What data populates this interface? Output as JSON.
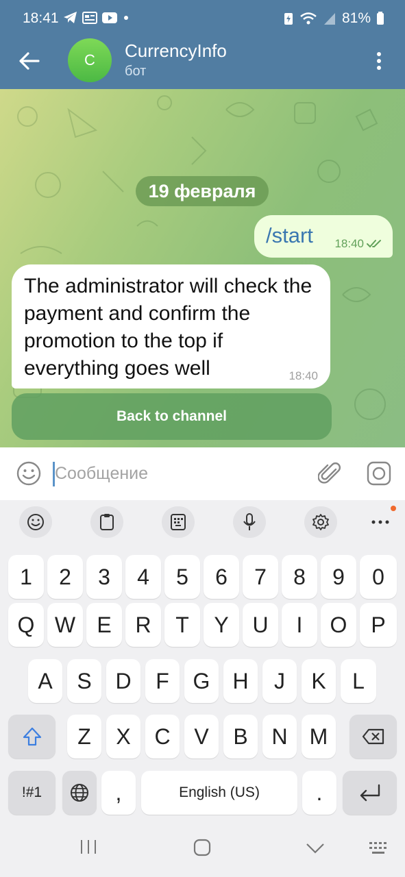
{
  "status_bar": {
    "time": "18:41",
    "battery": "81%",
    "icons": [
      "telegram-icon",
      "news-icon",
      "youtube-icon",
      "dot-icon",
      "battery-saver-icon",
      "wifi-icon",
      "signal-icon",
      "battery-icon"
    ]
  },
  "header": {
    "avatar_letter": "C",
    "title": "CurrencyInfo",
    "subtitle": "бот",
    "avatar_color": "#5bc44a",
    "bar_color": "#517da2"
  },
  "chat": {
    "date_chip": "19 февраля",
    "messages": [
      {
        "direction": "out",
        "text": "/start",
        "time": "18:40",
        "status": "read"
      },
      {
        "direction": "in",
        "text": "The administrator will check the payment and confirm the promotion to the top if everything goes well",
        "time": "18:40"
      }
    ],
    "inline_button": "Back to channel"
  },
  "composer": {
    "placeholder": "Сообщение",
    "value": ""
  },
  "keyboard_toolbar": [
    "emoji-icon",
    "clipboard-icon",
    "keypad-icon",
    "microphone-icon",
    "settings-icon",
    "more-icon"
  ],
  "keyboard": {
    "row1": [
      "1",
      "2",
      "3",
      "4",
      "5",
      "6",
      "7",
      "8",
      "9",
      "0"
    ],
    "row2": [
      "Q",
      "W",
      "E",
      "R",
      "T",
      "Y",
      "U",
      "I",
      "O",
      "P"
    ],
    "row3": [
      "A",
      "S",
      "D",
      "F",
      "G",
      "H",
      "J",
      "K",
      "L"
    ],
    "row4": [
      "Z",
      "X",
      "C",
      "V",
      "B",
      "N",
      "M"
    ],
    "symbols": "!#1",
    "comma": ",",
    "space": "English (US)",
    "period": "."
  },
  "nav_bar": [
    "recents-icon",
    "home-icon",
    "back-icon",
    "keyboard-grid-icon"
  ]
}
